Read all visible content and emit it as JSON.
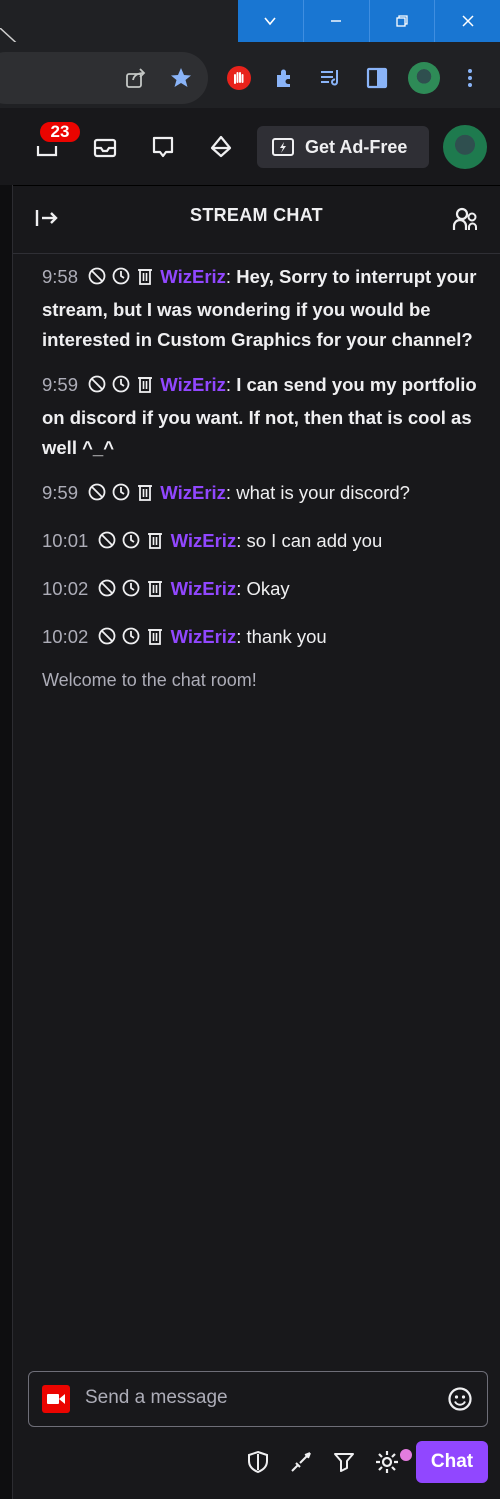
{
  "topnav": {
    "notifications_count": "23",
    "adfree_label": "Get Ad-Free"
  },
  "chat": {
    "title": "STREAM CHAT",
    "messages": [
      {
        "time": "9:58",
        "user": "WizEriz",
        "text": "Hey, Sorry to interrupt your stream, but I was wondering if you would be interested in Custom Graphics for your channel?",
        "bold": true
      },
      {
        "time": "9:59",
        "user": "WizEriz",
        "text": "I can send you my portfolio on discord if you want. If not, then that is cool as well ^_^",
        "bold": true
      },
      {
        "time": "9:59",
        "user": "WizEriz",
        "text": "what is your discord?",
        "bold": false
      },
      {
        "time": "10:01",
        "user": "WizEriz",
        "text": "so I can add you",
        "bold": false
      },
      {
        "time": "10:02",
        "user": "WizEriz",
        "text": "Okay",
        "bold": false
      },
      {
        "time": "10:02",
        "user": "WizEriz",
        "text": "thank you",
        "bold": false
      }
    ],
    "welcome": "Welcome to the chat room!",
    "input_placeholder": "Send a message",
    "chat_button": "Chat"
  },
  "colors": {
    "accent": "#9147ff",
    "badge": "#eb0400",
    "background": "#18181b",
    "window_controls": "#1976d2"
  },
  "icons": {
    "window": [
      "chevron-down-icon",
      "minimize-icon",
      "restore-icon",
      "close-icon"
    ],
    "browser": [
      "share-icon",
      "star-icon",
      "adblock-icon",
      "extensions-icon",
      "media-queue-icon",
      "sidepanel-icon",
      "profile-avatar",
      "menu-icon"
    ],
    "nav": [
      "inbox-icon",
      "whispers-icon",
      "prime-icon"
    ],
    "chat_header": [
      "collapse-icon",
      "community-icon"
    ],
    "chat_footer": [
      "mod-shield-icon",
      "sword-icon",
      "prediction-icon",
      "settings-icon"
    ]
  }
}
